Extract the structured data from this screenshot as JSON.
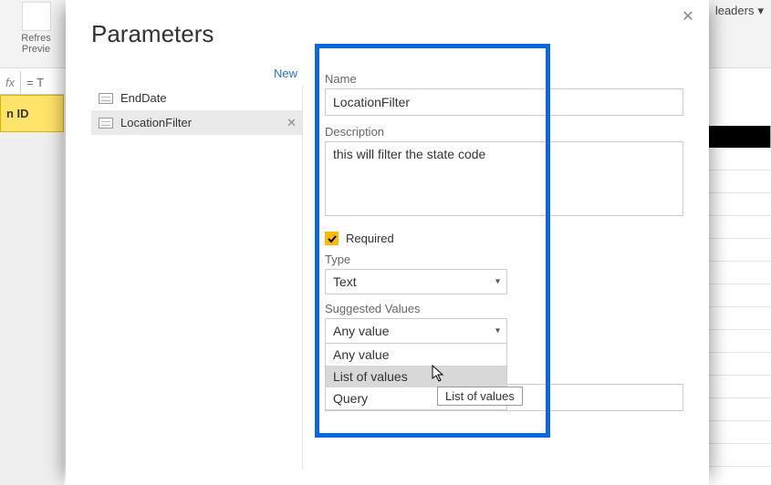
{
  "ribbon": {
    "refresh_label": "Refres",
    "preview_label": "Previe",
    "headers_label": "leaders"
  },
  "fx": {
    "label": "fx",
    "cell": "= T"
  },
  "grid": {
    "col_header": "n ID"
  },
  "dialog": {
    "title": "Parameters",
    "new_link": "New",
    "params": [
      {
        "label": "EndDate",
        "selected": false
      },
      {
        "label": "LocationFilter",
        "selected": true
      }
    ],
    "form": {
      "name_label": "Name",
      "name_value": "LocationFilter",
      "desc_label": "Description",
      "desc_value": "this will filter the state code",
      "required_label": "Required",
      "type_label": "Type",
      "type_value": "Text",
      "sv_label": "Suggested Values",
      "sv_value": "Any value",
      "sv_options": [
        "Any value",
        "List of values",
        "Query"
      ]
    }
  },
  "tooltip": "List of values"
}
